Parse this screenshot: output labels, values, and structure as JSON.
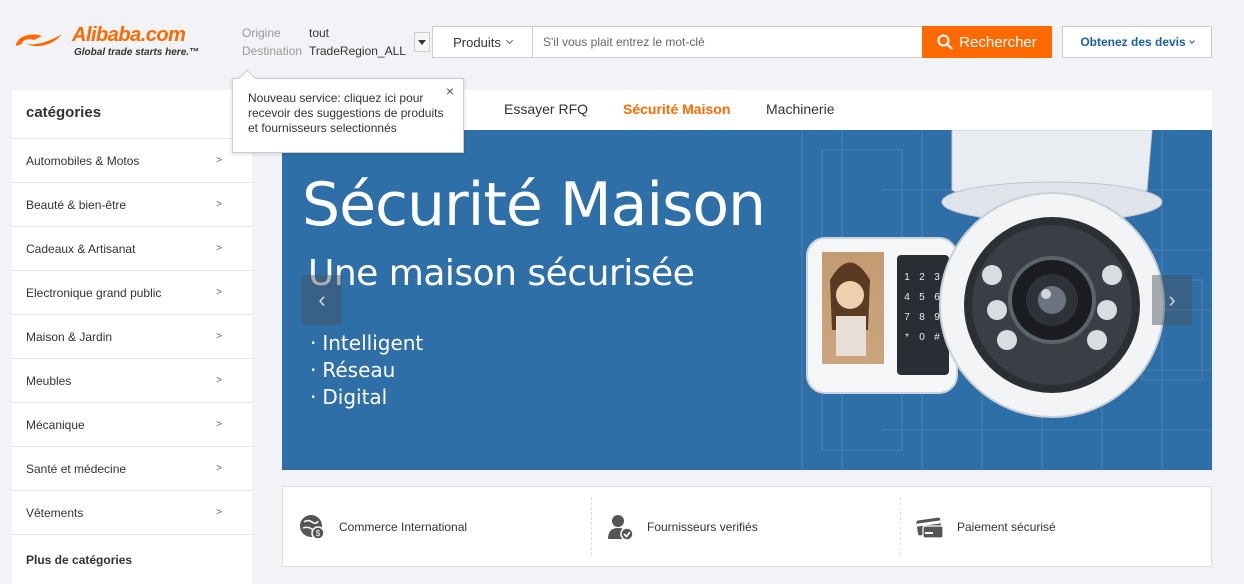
{
  "header": {
    "logo": {
      "word": "Alibaba.com",
      "tagline": "Global trade starts here.™"
    },
    "origin_label": "Origine",
    "origin_value": "tout",
    "destination_label": "Destination",
    "destination_value": "TradeRegion_ALL",
    "search": {
      "category": "Produits",
      "placeholder": "S'il vous plait entrez le mot-clé",
      "button_label": "Rechercher"
    },
    "quote_button": "Obtenez des devis"
  },
  "tooltip": {
    "line1": "Nouveau service: cliquez ici pour",
    "line2": "recevoir des suggestions de produits",
    "line3": "et fournisseurs selectionnés",
    "close": "×"
  },
  "sidebar": {
    "title": "catégories",
    "items": [
      "Automobiles & Motos",
      "Beauté & bien-être",
      "Cadeaux & Artisanat",
      "Electronique grand public",
      "Maison & Jardin",
      "Meubles",
      "Mécanique",
      "Santé et médecine",
      "Vêtements"
    ],
    "more": "Plus de catégories",
    "arrow": ">"
  },
  "tabs": {
    "items": [
      "Essayer RFQ",
      "Sécurité Maison",
      "Machinerie"
    ],
    "active_index": 1
  },
  "banner": {
    "title": "Sécurité Maison",
    "subtitle": "Une maison sécurisée",
    "bullets": [
      "Intelligent",
      "Réseau",
      "Digital"
    ],
    "keypad": [
      "1",
      "2",
      "3",
      "4",
      "5",
      "6",
      "7",
      "8",
      "9",
      "*",
      "0",
      "#"
    ],
    "prev": "‹",
    "next": "›"
  },
  "features": [
    {
      "label": "Commerce International",
      "icon": "globe-dollar-icon"
    },
    {
      "label": "Fournisseurs verifiés",
      "icon": "verified-supplier-icon"
    },
    {
      "label": "Paiement sécurisé",
      "icon": "secure-payment-card-icon"
    }
  ],
  "colors": {
    "accent": "#ff6a00",
    "link": "#1c5fa5",
    "banner_bg": "#2f6fa8"
  }
}
